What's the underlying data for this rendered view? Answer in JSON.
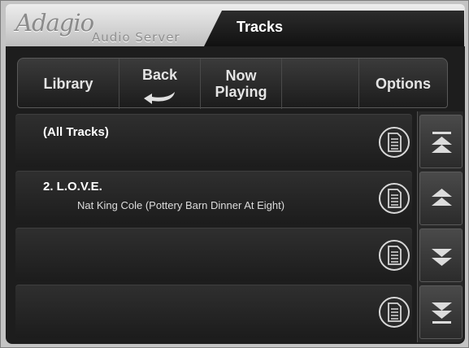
{
  "header": {
    "logo_script": "Adagio",
    "logo_sub": "Audio Server",
    "title": "Tracks"
  },
  "nav": {
    "library": "Library",
    "back": "Back",
    "now_playing_1": "Now",
    "now_playing_2": "Playing",
    "options": "Options"
  },
  "tracks": [
    {
      "title": "(All Tracks)",
      "subtitle": ""
    },
    {
      "title": "2. L.O.V.E.",
      "subtitle": "Nat King Cole (Pottery Barn Dinner At Eight)"
    },
    {
      "title": "",
      "subtitle": ""
    },
    {
      "title": "",
      "subtitle": ""
    }
  ],
  "icons": {
    "row_action": "document-icon",
    "scroll_top": "double-chevron-up-icon",
    "scroll_up": "chevron-up-icon",
    "scroll_down": "chevron-down-icon",
    "scroll_bottom": "double-chevron-down-icon",
    "back": "back-arrow-icon"
  },
  "colors": {
    "panel": "#1d1d1d",
    "text": "#ffffff",
    "header": "#d2d2d2"
  }
}
